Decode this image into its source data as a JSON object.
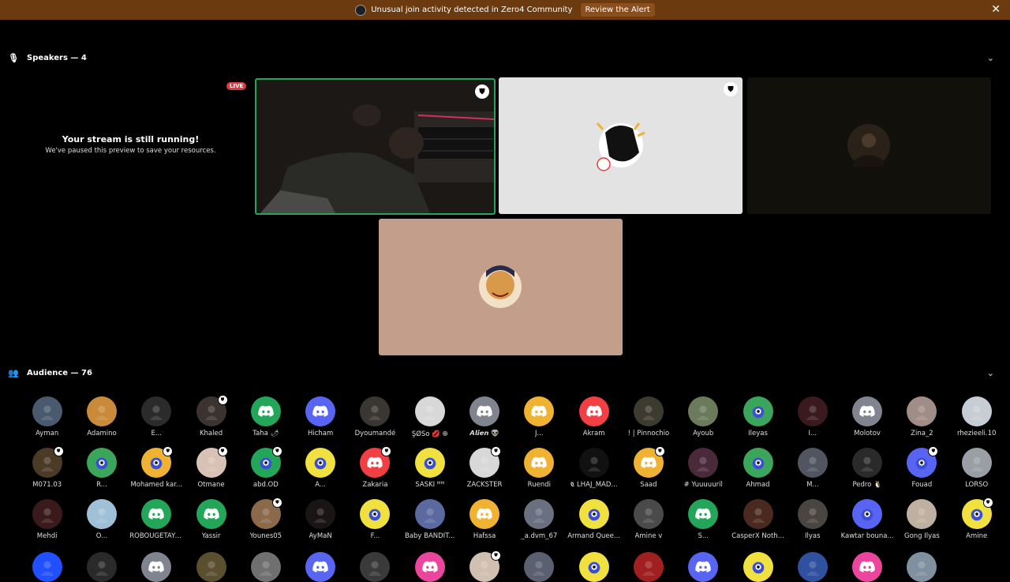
{
  "alert": {
    "message": "Unusual join activity detected in Zero4 Community",
    "action": "Review the Alert",
    "close": "✕"
  },
  "speakers": {
    "header": "Speakers — 4",
    "live": "LIVE",
    "paused_title": "Your stream is still running!",
    "paused_subtitle": "We've paused this preview to save your resources."
  },
  "audience": {
    "header": "Audience — 76",
    "rows": [
      [
        {
          "name": "Ayman",
          "color": "#4a5a6e",
          "icon": "photo"
        },
        {
          "name": "Adamino",
          "color": "#c98a3a",
          "icon": "photo"
        },
        {
          "name": "E...",
          "color": "#2b2b2b",
          "icon": "photo"
        },
        {
          "name": "Khaled",
          "color": "#3a3330",
          "icon": "photo",
          "mod": true
        },
        {
          "name": "Taha 🌶",
          "color": "#23a55a",
          "icon": "discord"
        },
        {
          "name": "Hicham",
          "color": "#5865f2",
          "icon": "discord"
        },
        {
          "name": "Dyoumandé",
          "color": "#3a3632",
          "icon": "photo"
        },
        {
          "name": "ŞØSo 💋 ֍",
          "color": "#d8d8d8",
          "icon": "photo"
        },
        {
          "name": "𝘼𝙡𝙞𝙚𝙣 👽",
          "color": "#80848e",
          "icon": "discord"
        },
        {
          "name": "J...",
          "color": "#f0b232",
          "icon": "discord"
        },
        {
          "name": "Akram",
          "color": "#f23f43",
          "icon": "discord"
        },
        {
          "name": "! | Pinnochio",
          "color": "#3d3a30",
          "icon": "photo"
        },
        {
          "name": "Ayoub",
          "color": "#6a7a5a",
          "icon": "photo"
        },
        {
          "name": "Ileyas",
          "color": "#3ba55c",
          "icon": "mascot"
        },
        {
          "name": "I...",
          "color": "#3a1a1e",
          "icon": "photo"
        },
        {
          "name": "Molotov",
          "color": "#80848e",
          "icon": "discord"
        },
        {
          "name": "Zina_2",
          "color": "#a08d88",
          "icon": "photo"
        },
        {
          "name": "rhezieeli.10",
          "color": "#c8cdd5",
          "icon": "photo"
        }
      ],
      [
        {
          "name": "M071.03",
          "color": "#4a3a26",
          "icon": "photo",
          "mod": true
        },
        {
          "name": "R...",
          "color": "#3ba55c",
          "icon": "mascot"
        },
        {
          "name": "Mohamed kar...",
          "color": "#f0b232",
          "icon": "mascot",
          "mod": true
        },
        {
          "name": "Otmane",
          "color": "#d9c1b5",
          "icon": "photo",
          "mod": true
        },
        {
          "name": "abd.OD",
          "color": "#23a55a",
          "icon": "mascot",
          "mod": true
        },
        {
          "name": "A...",
          "color": "#f0e040",
          "icon": "mascot"
        },
        {
          "name": "Zakaria",
          "color": "#f23f43",
          "icon": "discord",
          "mod": true
        },
        {
          "name": "SASKI ᴹᴹ",
          "color": "#f0e040",
          "icon": "mascot"
        },
        {
          "name": "ZACKSTER",
          "color": "#d8d8d8",
          "icon": "photo",
          "mod": true
        },
        {
          "name": "Ruendi",
          "color": "#f0b232",
          "icon": "discord"
        },
        {
          "name": "𝕮 LHAJ_MAD...",
          "color": "#111111",
          "icon": "photo"
        },
        {
          "name": "Saad",
          "color": "#f0b232",
          "icon": "discord",
          "mod": true
        },
        {
          "name": "# Yuuuuuril",
          "color": "#4a2a3a",
          "icon": "photo"
        },
        {
          "name": "Ahmad",
          "color": "#3ba55c",
          "icon": "mascot"
        },
        {
          "name": "M...",
          "color": "#505560",
          "icon": "photo"
        },
        {
          "name": "Pedro 🐧",
          "color": "#2a2a2a",
          "icon": "photo"
        },
        {
          "name": "Fouad",
          "color": "#5865f2",
          "icon": "mascot",
          "mod": true
        },
        {
          "name": "LORSO",
          "color": "#9a9ea5",
          "icon": "photo"
        }
      ],
      [
        {
          "name": "Mehdi",
          "color": "#3a1a1a",
          "icon": "photo"
        },
        {
          "name": "O...",
          "color": "#a0c0d8",
          "icon": "photo"
        },
        {
          "name": "ROBOUGETAYA ...",
          "color": "#23a55a",
          "icon": "discord"
        },
        {
          "name": "Yassir",
          "color": "#23a55a",
          "icon": "discord"
        },
        {
          "name": "Younes05",
          "color": "#8a6a4a",
          "icon": "photo",
          "mod": true
        },
        {
          "name": "AyMaN",
          "color": "#1a1414",
          "icon": "photo"
        },
        {
          "name": "F...",
          "color": "#f0e040",
          "icon": "mascot"
        },
        {
          "name": "Baby BANDIT...",
          "color": "#5a6aa0",
          "icon": "photo"
        },
        {
          "name": "Hafssa",
          "color": "#f0b232",
          "icon": "discord"
        },
        {
          "name": "_a.dvm_67",
          "color": "#6a7080",
          "icon": "photo"
        },
        {
          "name": "Armand Quee...",
          "color": "#f0e040",
          "icon": "mascot"
        },
        {
          "name": "Amine v",
          "color": "#4a4a4a",
          "icon": "photo"
        },
        {
          "name": "S...",
          "color": "#23a55a",
          "icon": "discord"
        },
        {
          "name": "CasperX Noth...",
          "color": "#4a2a20",
          "icon": "photo"
        },
        {
          "name": "Ilyas",
          "color": "#4a4540",
          "icon": "photo"
        },
        {
          "name": "Kawtar bouna...",
          "color": "#5865f2",
          "icon": "mascot"
        },
        {
          "name": "Gong Ilyas",
          "color": "#c0b0a0",
          "icon": "photo"
        },
        {
          "name": "Amine",
          "color": "#f0e040",
          "icon": "mascot",
          "mod": true
        }
      ],
      [
        {
          "name": "",
          "color": "#2050ff",
          "icon": "photo"
        },
        {
          "name": "",
          "color": "#2a2a2a",
          "icon": "photo"
        },
        {
          "name": "",
          "color": "#80848e",
          "icon": "discord"
        },
        {
          "name": "",
          "color": "#5a5030",
          "icon": "photo"
        },
        {
          "name": "",
          "color": "#707070",
          "icon": "photo"
        },
        {
          "name": "",
          "color": "#5865f2",
          "icon": "discord"
        },
        {
          "name": "",
          "color": "#3a3a3a",
          "icon": "photo"
        },
        {
          "name": "",
          "color": "#eb459e",
          "icon": "discord"
        },
        {
          "name": "",
          "color": "#d0c0b0",
          "icon": "photo",
          "mod": true
        },
        {
          "name": "",
          "color": "#5a6070",
          "icon": "photo"
        },
        {
          "name": "",
          "color": "#f0e040",
          "icon": "mascot"
        },
        {
          "name": "",
          "color": "#a02020",
          "icon": "photo"
        },
        {
          "name": "",
          "color": "#5865f2",
          "icon": "discord"
        },
        {
          "name": "",
          "color": "#f0e040",
          "icon": "mascot"
        },
        {
          "name": "",
          "color": "#3050a0",
          "icon": "photo"
        },
        {
          "name": "",
          "color": "#eb459e",
          "icon": "discord"
        },
        {
          "name": "",
          "color": "#8090a0",
          "icon": "photo"
        }
      ]
    ]
  }
}
